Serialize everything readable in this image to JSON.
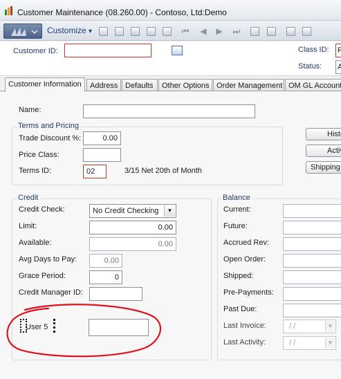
{
  "window": {
    "title": "Customer Maintenance (08.260.00) - Contoso, Ltd:Demo"
  },
  "toolbar": {
    "customize_label": "Customize",
    "customize_arrow": "▾"
  },
  "header": {
    "customer_id_label": "Customer ID:",
    "customer_id_value": "",
    "class_id_label": "Class ID:",
    "class_id_value": "R",
    "status_label": "Status:",
    "status_value": "A"
  },
  "tabs": [
    {
      "label": "Customer Information"
    },
    {
      "label": "Address"
    },
    {
      "label": "Defaults"
    },
    {
      "label": "Other Options"
    },
    {
      "label": "Order Management"
    },
    {
      "label": "OM GL Accounts"
    }
  ],
  "info": {
    "name_label": "Name:",
    "name_value": "",
    "terms_group_title": "Terms and Pricing",
    "trade_discount_label": "Trade Discount %:",
    "trade_discount_value": "0.00",
    "price_class_label": "Price Class:",
    "price_class_value": "",
    "terms_id_label": "Terms ID:",
    "terms_id_value": "02",
    "terms_description": "3/15 Net 20th of Month"
  },
  "side_buttons": [
    {
      "label": "History"
    },
    {
      "label": "Activity"
    },
    {
      "label": "Shipping Addresses"
    }
  ],
  "credit": {
    "group_title": "Credit",
    "credit_check_label": "Credit Check:",
    "credit_check_value": "No Credit Checking",
    "limit_label": "Limit:",
    "limit_value": "0.00",
    "available_label": "Available:",
    "available_value": "0.00",
    "avg_days_label": "Avg Days to Pay:",
    "avg_days_value": "0.00",
    "grace_label": "Grace Period:",
    "grace_value": "0",
    "manager_label": "Credit Manager ID:",
    "manager_value": "",
    "user5_label": "User 5",
    "user5_value": ""
  },
  "balance": {
    "group_title": "Balance",
    "current_label": "Current:",
    "future_label": "Future:",
    "accrued_label": "Accrued Rev:",
    "open_order_label": "Open Order:",
    "shipped_label": "Shipped:",
    "prepayments_label": "Pre-Payments:",
    "past_due_label": "Past Due:",
    "last_invoice_label": "Last Invoice:",
    "last_invoice_value": "/ /",
    "last_activity_label": "Last Activity:",
    "last_activity_value": "/ /"
  },
  "colors": {
    "highlight_ring": "#e0101c",
    "required_border": "#c0392b",
    "label_blue": "#1f3a66"
  }
}
